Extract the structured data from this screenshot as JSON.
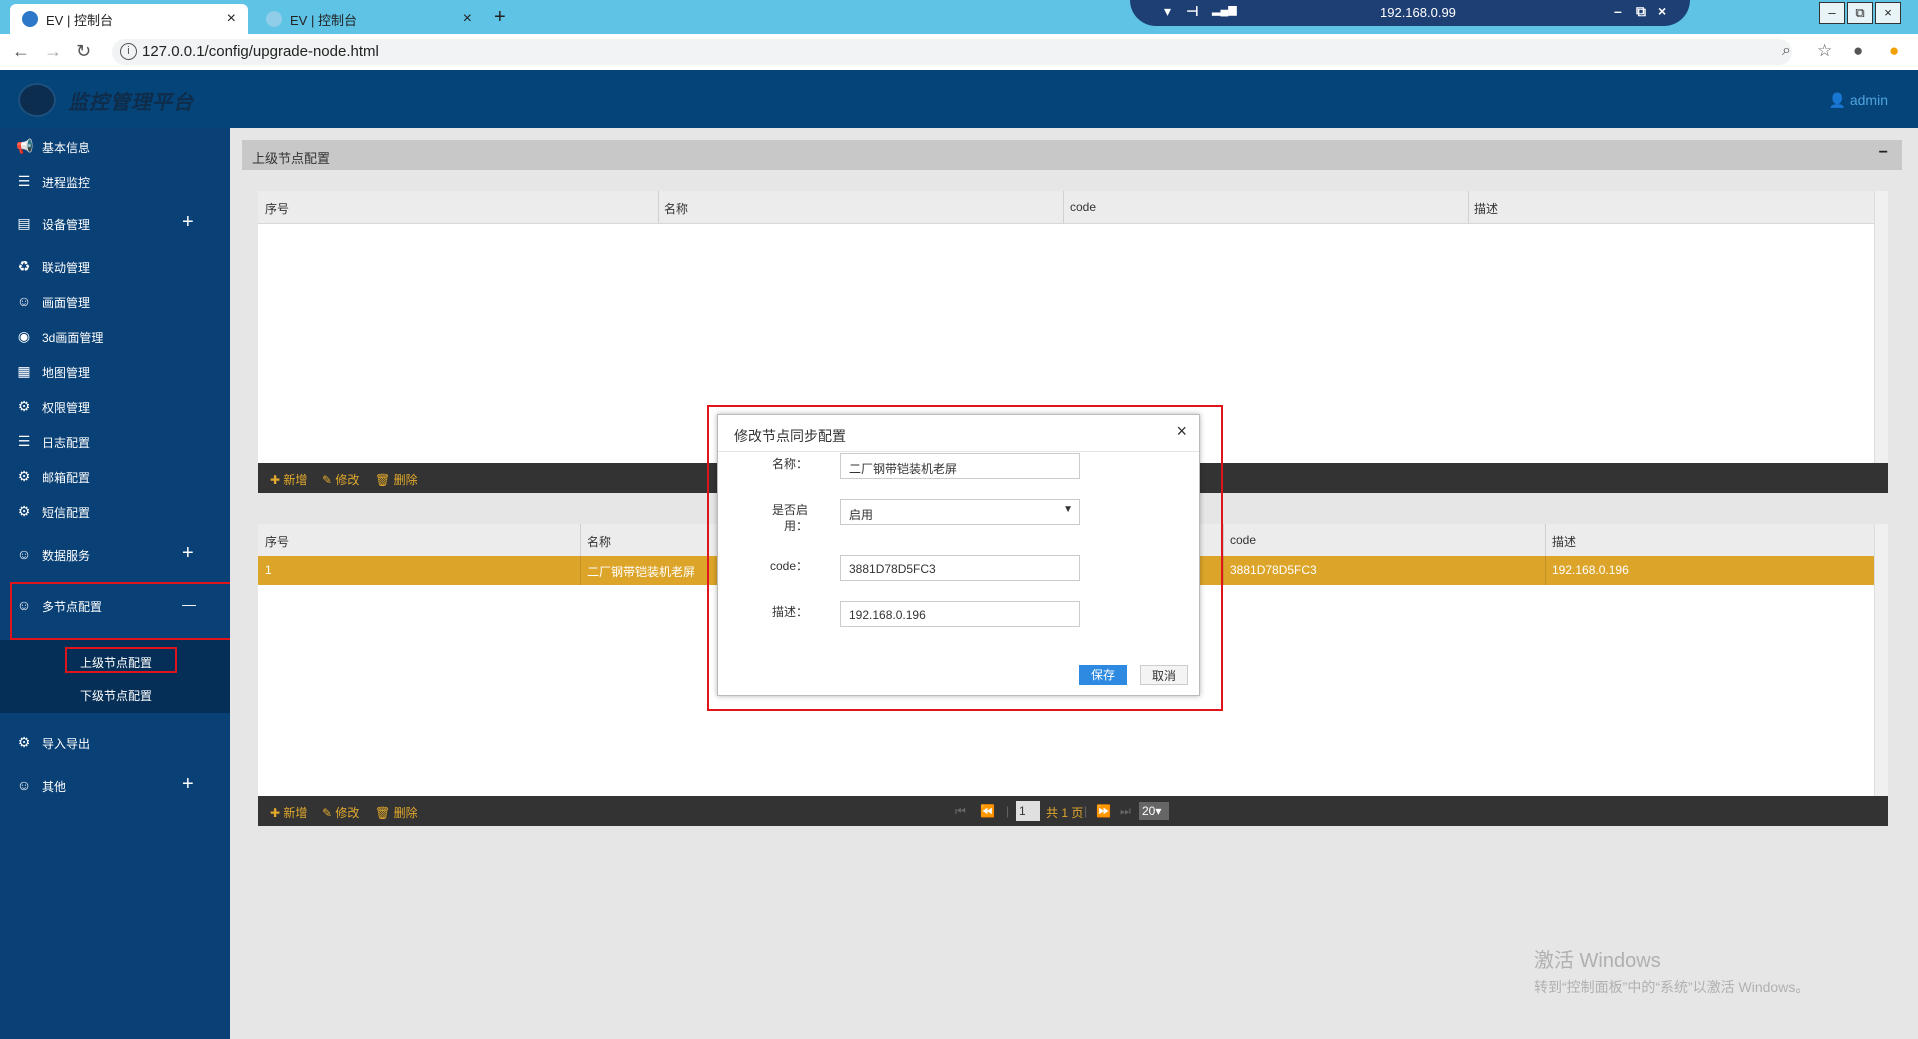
{
  "browser": {
    "tabs": [
      {
        "label": "EV | 控制台"
      },
      {
        "label": "EV | 控制台"
      }
    ],
    "url": "127.0.0.1/config/upgrade-node.html",
    "remote_ip": "192.168.0.99"
  },
  "app": {
    "title": "监控管理平台",
    "user": "admin"
  },
  "sidebar": {
    "items": [
      {
        "label": "基本信息",
        "icon": "megaphone-icon",
        "expand": ""
      },
      {
        "label": "进程监控",
        "icon": "server-icon",
        "expand": ""
      },
      {
        "label": "设备管理",
        "icon": "briefcase-icon",
        "expand": "+"
      },
      {
        "label": "联动管理",
        "icon": "recycle-icon",
        "expand": ""
      },
      {
        "label": "画面管理",
        "icon": "smile-icon",
        "expand": ""
      },
      {
        "label": "3d画面管理",
        "icon": "eye-icon",
        "expand": ""
      },
      {
        "label": "地图管理",
        "icon": "calendar-icon",
        "expand": ""
      },
      {
        "label": "权限管理",
        "icon": "gear-icon",
        "expand": ""
      },
      {
        "label": "日志配置",
        "icon": "server-icon",
        "expand": ""
      },
      {
        "label": "邮箱配置",
        "icon": "gear-icon",
        "expand": ""
      },
      {
        "label": "短信配置",
        "icon": "gear-icon",
        "expand": ""
      },
      {
        "label": "数据服务",
        "icon": "smile-icon",
        "expand": "+"
      },
      {
        "label": "多节点配置",
        "icon": "smile-icon",
        "expand": "—"
      },
      {
        "label": "导入导出",
        "icon": "gear-icon",
        "expand": ""
      },
      {
        "label": "其他",
        "icon": "smile-icon",
        "expand": "+"
      }
    ],
    "submenu": [
      "上级节点配置",
      "下级节点配置"
    ]
  },
  "panel": {
    "title": "上级节点配置",
    "collapse": "−"
  },
  "grid1": {
    "columns": [
      "序号",
      "名称",
      "code",
      "描述"
    ],
    "toolbar": {
      "add": "新增",
      "edit": "修改",
      "delete": "删除"
    }
  },
  "grid2": {
    "columns": [
      "序号",
      "名称",
      "code",
      "描述"
    ],
    "row": {
      "index": "1",
      "name": "二厂钢带铠装机老屏",
      "code": "3881D78D5FC3",
      "desc": "192.168.0.196"
    },
    "toolbar": {
      "add": "新增",
      "edit": "修改",
      "delete": "删除"
    },
    "pager": {
      "page": "1",
      "total": "共 1 页",
      "size": "20"
    }
  },
  "modal": {
    "title": "修改节点同步配置",
    "fields": {
      "name_label": "名称：",
      "name_value": "二厂钢带铠装机老屏",
      "enabled_label_1": "是否启",
      "enabled_label_2": "用：",
      "enabled_value": "启用",
      "code_label": "code：",
      "code_value": "3881D78D5FC3",
      "desc_label": "描述：",
      "desc_value": "192.168.0.196"
    },
    "save": "保存",
    "cancel": "取消"
  },
  "watermark": {
    "line1": "激活 Windows",
    "line2": "转到“控制面板”中的“系统”以激活 Windows。"
  },
  "colors": {
    "header": "#054478",
    "sidebar": "#094075",
    "highlight_row": "#dca52a",
    "toolbar": "#333333",
    "primary_button": "#2d8ae0",
    "annotation_red": "#e0151c"
  }
}
